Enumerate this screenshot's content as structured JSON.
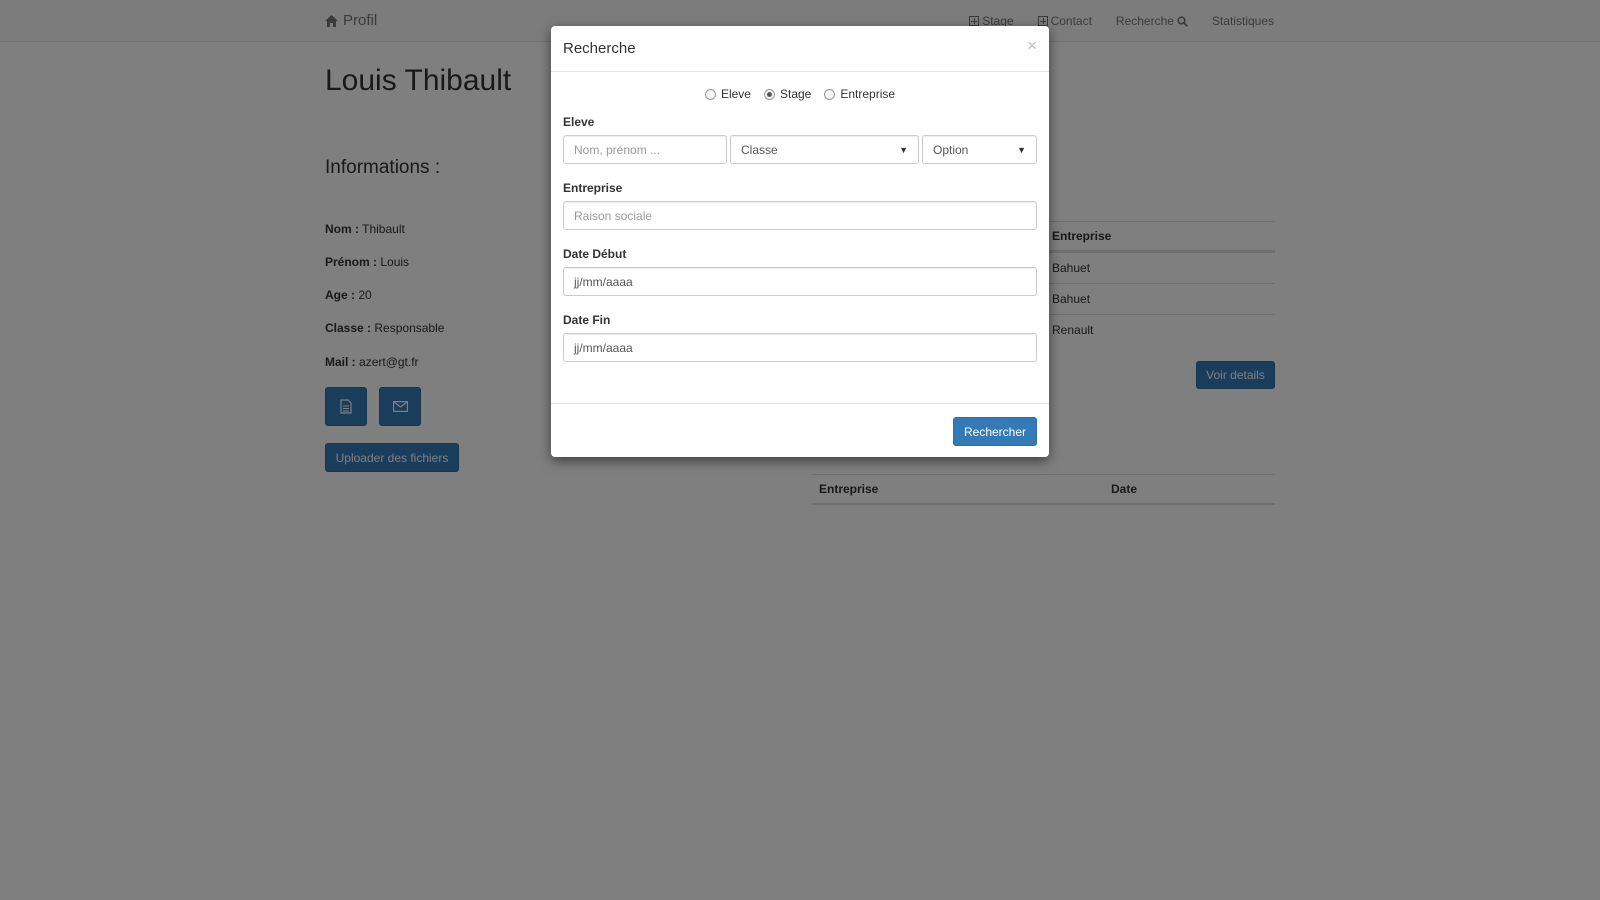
{
  "navbar": {
    "brand": "Profil",
    "links": [
      {
        "label": "Stage",
        "icon": "plus-square-icon"
      },
      {
        "label": "Contact",
        "icon": "plus-square-icon"
      },
      {
        "label": "Recherche",
        "icon": "search-icon"
      },
      {
        "label": "Statistiques"
      }
    ]
  },
  "profile": {
    "name": "Louis Thibault",
    "section_title": "Informations :",
    "fields": [
      {
        "label": "Nom :",
        "value": "Thibault"
      },
      {
        "label": "Prénom :",
        "value": "Louis"
      },
      {
        "label": "Age :",
        "value": "20"
      },
      {
        "label": "Classe :",
        "value": "Responsable"
      },
      {
        "label": "Mail :",
        "value": "azert@gt.fr"
      }
    ],
    "upload_label": "Uploader des fichiers"
  },
  "stages_table": {
    "header": "Entreprise",
    "rows": [
      "Bahuet",
      "Bahuet",
      "Renault"
    ],
    "details_label": "Voir details"
  },
  "contacts_table": {
    "headers": [
      "Entreprise",
      "Date"
    ]
  },
  "modal": {
    "title": "Recherche",
    "close": "×",
    "radios": [
      {
        "label": "Eleve",
        "checked": false
      },
      {
        "label": "Stage",
        "checked": true
      },
      {
        "label": "Entreprise",
        "checked": false
      }
    ],
    "eleve_label": "Eleve",
    "eleve_placeholder": "Nom, prénom ...",
    "classe_select": "Classe",
    "option_select": "Option",
    "entreprise_label": "Entreprise",
    "entreprise_placeholder": "Raison sociale",
    "date_debut_label": "Date Début",
    "date_debut_value": "jj/mm/aaaa",
    "date_fin_label": "Date Fin",
    "date_fin_value": "jj/mm/aaaa",
    "submit_label": "Rechercher"
  },
  "colors": {
    "primary": "#337ab7",
    "overlay": "rgba(0,0,0,0.5)"
  }
}
